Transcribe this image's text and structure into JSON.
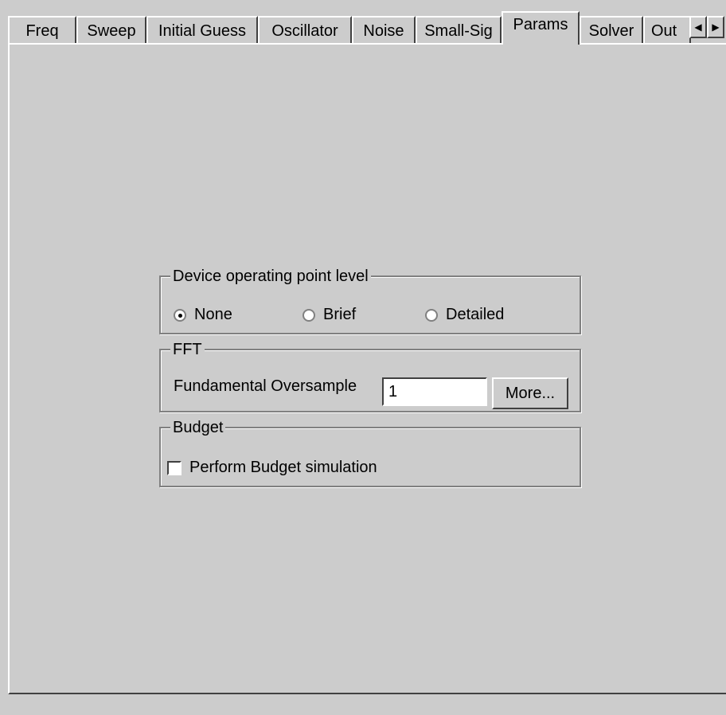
{
  "tabs": [
    {
      "label": "Freq"
    },
    {
      "label": "Sweep"
    },
    {
      "label": "Initial Guess"
    },
    {
      "label": "Oscillator"
    },
    {
      "label": "Noise"
    },
    {
      "label": "Small-Sig"
    },
    {
      "label": "Params",
      "active": true
    },
    {
      "label": "Solver"
    },
    {
      "label": "Out"
    }
  ],
  "tab_scroll": {
    "left_icon": "arrow-left-icon",
    "right_icon": "arrow-right-icon"
  },
  "operating_point": {
    "title": "Device operating point level",
    "options": [
      "None",
      "Brief",
      "Detailed"
    ],
    "selected": "None"
  },
  "fft": {
    "title": "FFT",
    "label": "Fundamental Oversample",
    "value": "1",
    "more_button": "More..."
  },
  "budget": {
    "title": "Budget",
    "checkbox_label": "Perform Budget simulation",
    "checked": false
  },
  "colors": {
    "face": "#cccccc",
    "highlight": "#ffffff",
    "shadow": "#404040"
  }
}
